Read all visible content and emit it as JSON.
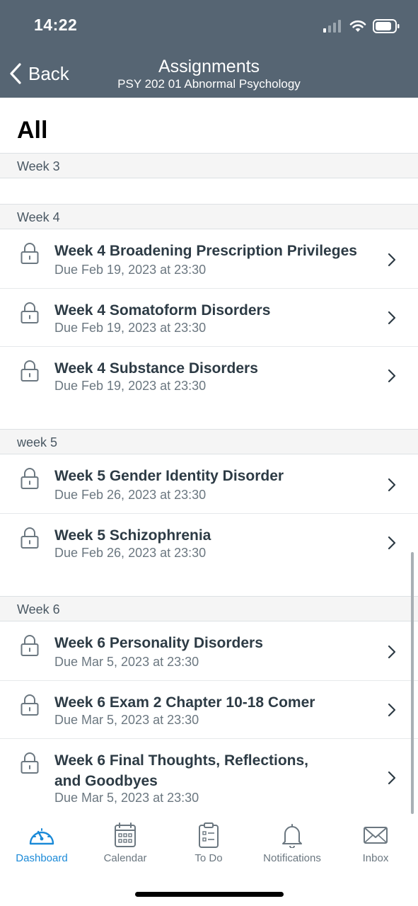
{
  "status_bar": {
    "time": "14:22"
  },
  "nav": {
    "back_label": "Back",
    "title": "Assignments",
    "subtitle": "PSY 202 01 Abnormal Psychology"
  },
  "filter": {
    "heading": "All"
  },
  "sections": [
    {
      "label": "Week 3",
      "items": []
    },
    {
      "label": "Week 4",
      "items": [
        {
          "title": "Week 4 Broadening Prescription Privileges",
          "due": "Due Feb 19, 2023 at 23:30",
          "locked": true
        },
        {
          "title": "Week 4 Somatoform Disorders",
          "due": "Due Feb 19, 2023 at 23:30",
          "locked": true
        },
        {
          "title": "Week 4 Substance Disorders",
          "due": "Due Feb 19, 2023 at 23:30",
          "locked": true
        }
      ]
    },
    {
      "label": "week 5",
      "items": [
        {
          "title": "Week 5 Gender Identity Disorder",
          "due": "Due Feb 26, 2023 at 23:30",
          "locked": true
        },
        {
          "title": "Week 5 Schizophrenia",
          "due": "Due Feb 26, 2023 at 23:30",
          "locked": true
        }
      ]
    },
    {
      "label": "Week 6",
      "items": [
        {
          "title": "Week 6 Personality Disorders",
          "due": "Due Mar 5, 2023 at 23:30",
          "locked": true
        },
        {
          "title": "Week 6 Exam 2 Chapter 10-18 Comer",
          "due": "Due Mar 5, 2023 at 23:30",
          "locked": true
        },
        {
          "title": "Week 6 Final Thoughts, Reflections, and Goodbyes",
          "due": "Due Mar 5, 2023 at 23:30",
          "locked": true
        }
      ]
    }
  ],
  "tabs": [
    {
      "label": "Dashboard",
      "icon": "dashboard-icon",
      "active": true
    },
    {
      "label": "Calendar",
      "icon": "calendar-icon",
      "active": false
    },
    {
      "label": "To Do",
      "icon": "todo-icon",
      "active": false
    },
    {
      "label": "Notifications",
      "icon": "bell-icon",
      "active": false
    },
    {
      "label": "Inbox",
      "icon": "inbox-icon",
      "active": false
    }
  ],
  "colors": {
    "header_bg": "#566573",
    "accent": "#1b8ad8",
    "text_primary": "#2d3b45",
    "text_secondary": "#6b7780"
  }
}
